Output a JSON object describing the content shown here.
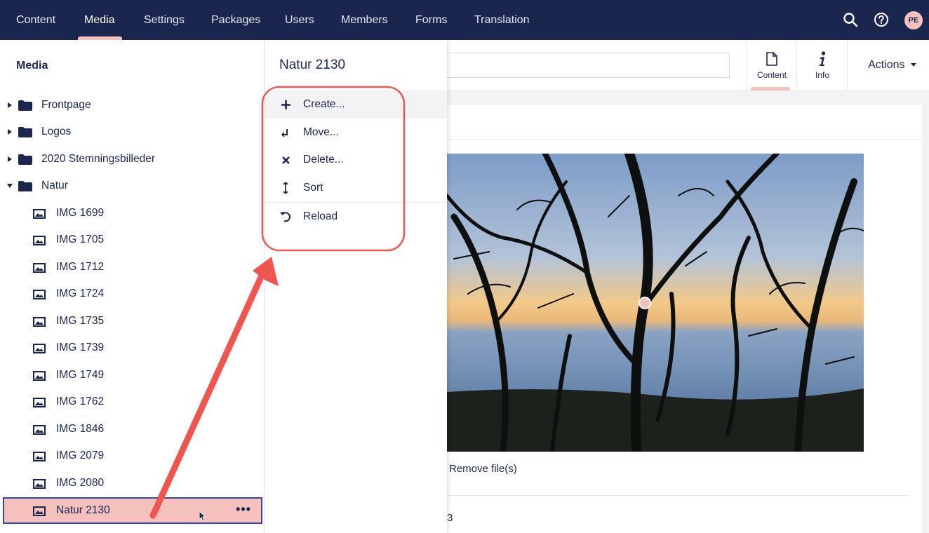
{
  "topnav": {
    "items": [
      "Content",
      "Media",
      "Settings",
      "Packages",
      "Users",
      "Members",
      "Forms",
      "Translation"
    ],
    "active": "Media",
    "user_initials": "PE"
  },
  "tree": {
    "header": "Media",
    "folders": [
      "Frontpage",
      "Logos",
      "2020 Stemningsbilleder",
      "Natur"
    ],
    "images": [
      "IMG 1699",
      "IMG 1705",
      "IMG 1712",
      "IMG 1724",
      "IMG 1735",
      "IMG 1739",
      "IMG 1749",
      "IMG 1762",
      "IMG 1846",
      "IMG 2079",
      "IMG 2080"
    ],
    "selected": "Natur 2130"
  },
  "context_menu": {
    "title": "Natur 2130",
    "items": [
      "Create...",
      "Move...",
      "Delete...",
      "Sort",
      "Reload"
    ]
  },
  "editor": {
    "apps": [
      "Content",
      "Info"
    ],
    "actions_label": "Actions",
    "remove_files": "Remove file(s)",
    "partial_value": "3"
  },
  "colors": {
    "header_bg": "#1b264f",
    "accent_pink": "#f5c1bc",
    "annotation_red": "#f0564f",
    "selection_outline": "#3544b1"
  }
}
